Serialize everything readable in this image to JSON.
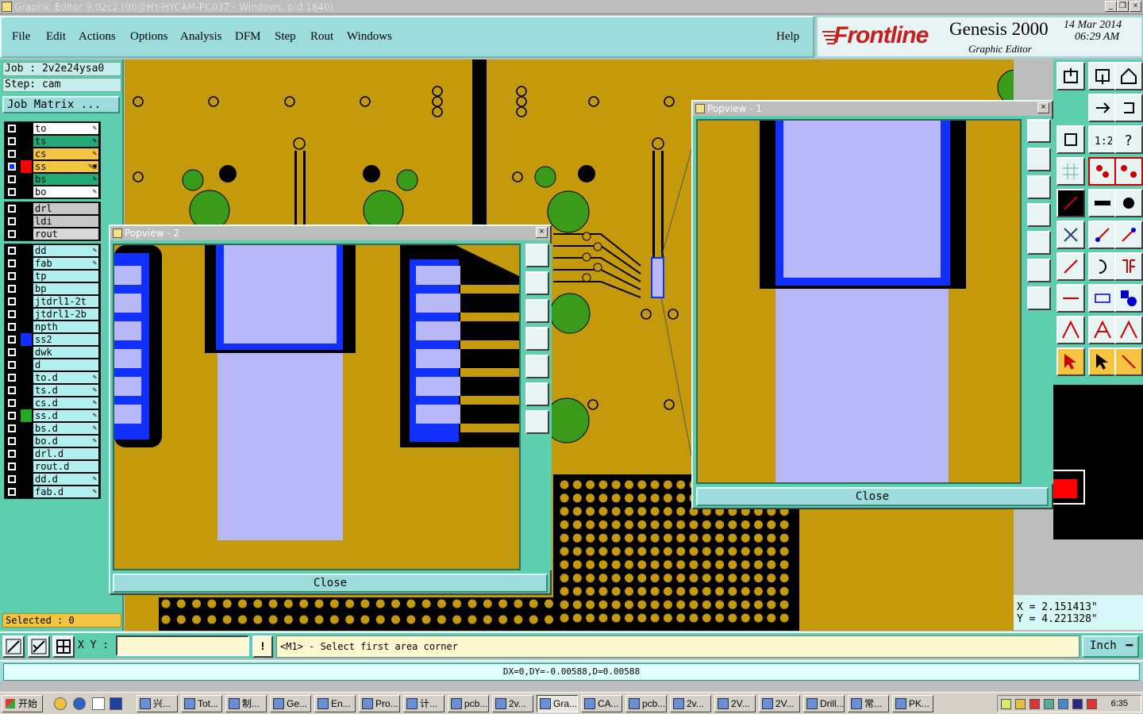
{
  "window": {
    "title": "Graphic Editor 9.02c2 (00@HY-HYCAM-PC037 - Windows, pid:1840)",
    "minimize": "_",
    "maximize": "❐",
    "close": "×"
  },
  "menu": {
    "file": "File",
    "edit": "Edit",
    "actions": "Actions",
    "options": "Options",
    "analysis": "Analysis",
    "dfm": "DFM",
    "step": "Step",
    "rout": "Rout",
    "windows": "Windows",
    "help": "Help"
  },
  "brand": {
    "logo": "Frontline",
    "product": "Genesis 2000",
    "subtitle": "Graphic Editor",
    "date": "14 Mar 2014",
    "time": "06:29 AM"
  },
  "job": {
    "job_line": "Job : 2v2e24ysa0",
    "step_line": "Step: cam",
    "matrix_button": "Job Matrix ..."
  },
  "layers": {
    "group1": [
      {
        "name": "to",
        "color": "#ffffff",
        "swatch": "#000000",
        "mark": "✎"
      },
      {
        "name": "ts",
        "color": "#22aa77",
        "swatch": "#000000",
        "mark": "✎"
      },
      {
        "name": "cs",
        "color": "#f5c542",
        "swatch": "#000000",
        "mark": "✎"
      },
      {
        "name": "ss",
        "color": "#f5c542",
        "swatch": "#ff0000",
        "mark": "✎▣",
        "active": true
      },
      {
        "name": "bs",
        "color": "#22aa77",
        "swatch": "#000000",
        "mark": "✎"
      },
      {
        "name": "bo",
        "color": "#ffffff",
        "swatch": "#000000",
        "mark": "✎"
      }
    ],
    "group2": [
      {
        "name": "drl",
        "color": "#c8c8c8",
        "swatch": "#000000",
        "mark": ""
      },
      {
        "name": "ldi",
        "color": "#c8c8c8",
        "swatch": "#000000",
        "mark": ""
      },
      {
        "name": "rout",
        "color": "#d8d8d8",
        "swatch": "#000000",
        "mark": ""
      }
    ],
    "group3": [
      {
        "name": "dd",
        "color": "#b0f0f0",
        "swatch": "#000000",
        "mark": "✎"
      },
      {
        "name": "fab",
        "color": "#b0f0f0",
        "swatch": "#000000",
        "mark": "✎"
      },
      {
        "name": "tp",
        "color": "#b0f0f0",
        "swatch": "#000000",
        "mark": ""
      },
      {
        "name": "bp",
        "color": "#b0f0f0",
        "swatch": "#000000",
        "mark": ""
      },
      {
        "name": "jtdrl1-2t",
        "color": "#b0f0f0",
        "swatch": "#000000",
        "mark": ""
      },
      {
        "name": "jtdrl1-2b",
        "color": "#b0f0f0",
        "swatch": "#000000",
        "mark": ""
      },
      {
        "name": "npth",
        "color": "#b0f0f0",
        "swatch": "#000000",
        "mark": ""
      },
      {
        "name": "ss2",
        "color": "#b0f0f0",
        "swatch": "#1030ff",
        "mark": ""
      },
      {
        "name": "dwk",
        "color": "#b0f0f0",
        "swatch": "#000000",
        "mark": ""
      },
      {
        "name": "d",
        "color": "#b0f0f0",
        "swatch": "#000000",
        "mark": ""
      },
      {
        "name": "to.d",
        "color": "#b0f0f0",
        "swatch": "#000000",
        "mark": "✎"
      },
      {
        "name": "ts.d",
        "color": "#b0f0f0",
        "swatch": "#000000",
        "mark": "✎"
      },
      {
        "name": "cs.d",
        "color": "#b0f0f0",
        "swatch": "#000000",
        "mark": "✎"
      },
      {
        "name": "ss.d",
        "color": "#b0f0f0",
        "swatch": "#22aa22",
        "mark": "✎"
      },
      {
        "name": "bs.d",
        "color": "#b0f0f0",
        "swatch": "#000000",
        "mark": "✎"
      },
      {
        "name": "bo.d",
        "color": "#b0f0f0",
        "swatch": "#000000",
        "mark": "✎"
      },
      {
        "name": "drl.d",
        "color": "#b0f0f0",
        "swatch": "#000000",
        "mark": ""
      },
      {
        "name": "rout.d",
        "color": "#b0f0f0",
        "swatch": "#000000",
        "mark": ""
      },
      {
        "name": "dd.d",
        "color": "#b0f0f0",
        "swatch": "#000000",
        "mark": "✎"
      },
      {
        "name": "fab.d",
        "color": "#b0f0f0",
        "swatch": "#000000",
        "mark": "✎"
      }
    ]
  },
  "selected": "Selected : 0",
  "popview1": {
    "title": "Popview - 1",
    "close_label": "Close"
  },
  "popview2": {
    "title": "Popview - 2",
    "close_label": "Close"
  },
  "coords": {
    "x": "X = 2.151413\"",
    "y": "Y = 4.221328\""
  },
  "cmdline": {
    "xy_label": "X Y :",
    "xy_value": "",
    "info_button": "!",
    "prompt": "<M1> - Select first area corner",
    "unit": "Inch",
    "unit_arrow": "━"
  },
  "status": "DX=0,DY=-0.00588,D=0.00588",
  "taskbar": {
    "start": "开始",
    "tasks": [
      "兴...",
      "Tot...",
      "制...",
      "Ge...",
      "En...",
      "Pro...",
      "计...",
      "pcb...",
      "2v...",
      "Gra...",
      "CA...",
      "pcb...",
      "2v...",
      "2V...",
      "2V...",
      "Drill...",
      "常...",
      "PK..."
    ],
    "active_task": "Gra...",
    "clock": "6:35"
  },
  "colors": {
    "board": "#c49a0c",
    "copper_dark": "#000000",
    "pad_fill": "#b8b8f8",
    "pad_outline": "#1030ff",
    "green_pad": "#3a9a1a"
  }
}
